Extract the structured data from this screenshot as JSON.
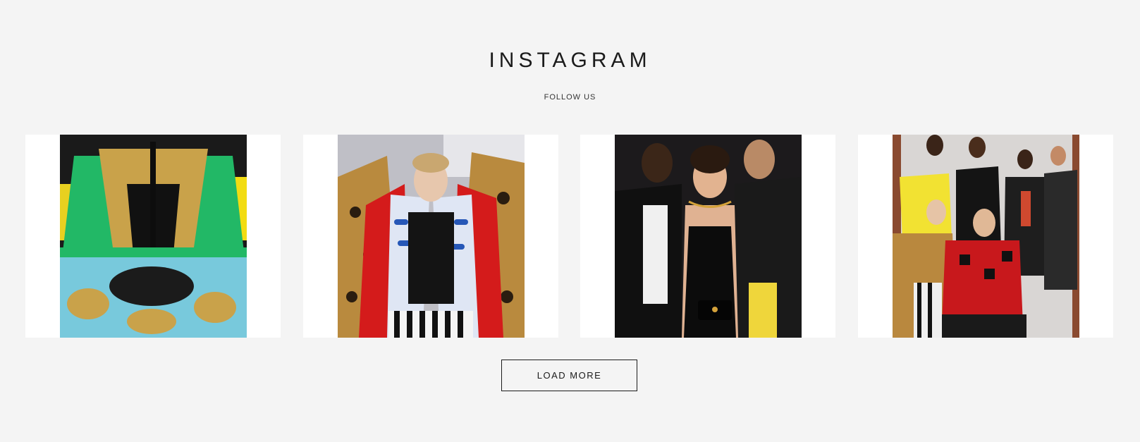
{
  "section": {
    "title": "INSTAGRAM",
    "subtitle": "FOLLOW US"
  },
  "posts": [
    {
      "name": "instagram-post-1",
      "icon": "photo-printed-jacket"
    },
    {
      "name": "instagram-post-2",
      "icon": "photo-leopard-coat-model"
    },
    {
      "name": "instagram-post-3",
      "icon": "photo-three-models-black-outfits"
    },
    {
      "name": "instagram-post-4",
      "icon": "photo-group-of-models"
    }
  ],
  "load_more": {
    "label": "LOAD MORE"
  },
  "colors": {
    "background": "#f4f4f4",
    "card": "#ffffff",
    "text": "#1b1b1b"
  }
}
